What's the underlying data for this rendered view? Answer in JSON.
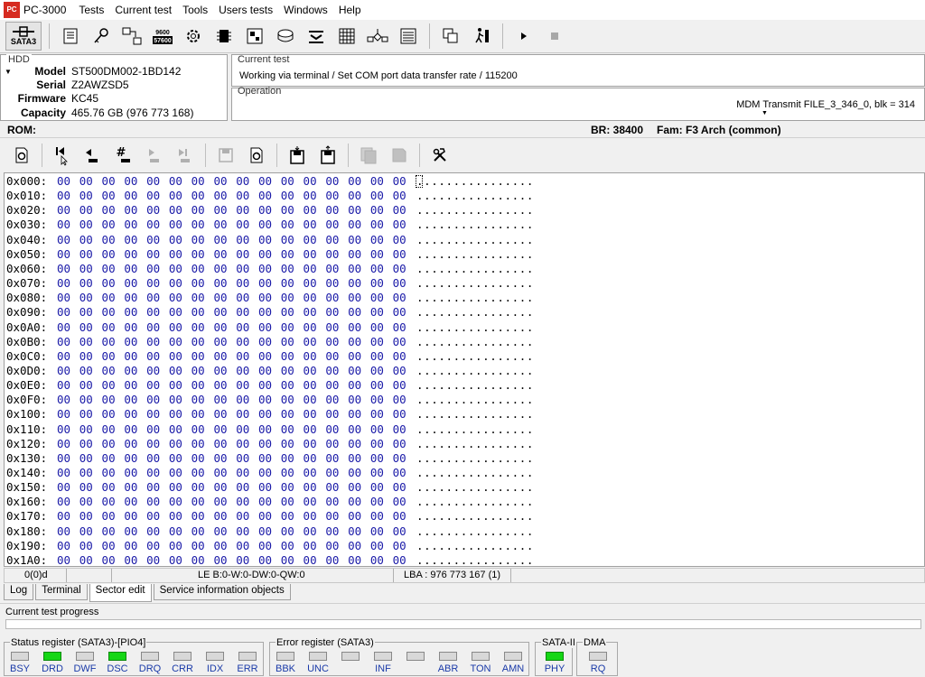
{
  "app": {
    "logo_text": "PC",
    "title": "PC-3000",
    "menu": [
      "Tests",
      "Current test",
      "Tools",
      "Users tests",
      "Windows",
      "Help"
    ]
  },
  "toolbar": {
    "sata3_label": "SATA3",
    "rate_top": "9600",
    "rate_bottom": "57600"
  },
  "hdd": {
    "legend": "HDD",
    "rows": [
      {
        "label": "Model",
        "value": "ST500DM002-1BD142"
      },
      {
        "label": "Serial",
        "value": "Z2AWZSD5"
      },
      {
        "label": "Firmware",
        "value": "KC45"
      },
      {
        "label": "Capacity",
        "value": "465.76 GB (976 773 168)"
      }
    ]
  },
  "current_test": {
    "legend": "Current test",
    "value": "Working via terminal / Set COM port data transfer rate / 115200"
  },
  "operation": {
    "legend": "Operation",
    "value": "MDM Transmit FILE_3_346_0, blk = 314"
  },
  "rom_bar": {
    "rom": "ROM:",
    "br": "BR: 38400",
    "fam": "Fam: F3 Arch (common)"
  },
  "hex": {
    "offsets": [
      "0x000:",
      "0x010:",
      "0x020:",
      "0x030:",
      "0x040:",
      "0x050:",
      "0x060:",
      "0x070:",
      "0x080:",
      "0x090:",
      "0x0A0:",
      "0x0B0:",
      "0x0C0:",
      "0x0D0:",
      "0x0E0:",
      "0x0F0:",
      "0x100:",
      "0x110:",
      "0x120:",
      "0x130:",
      "0x140:",
      "0x150:",
      "0x160:",
      "0x170:",
      "0x180:",
      "0x190:",
      "0x1A0:"
    ],
    "bytes": "00 00 00 00 00 00 00 00 00 00 00 00 00 00 00 00",
    "ascii": "................"
  },
  "sector_status": {
    "position": "0(0)d",
    "format": "LE B:0-W:0-DW:0-QW:0",
    "lba": "LBA : 976 773 167 (1)"
  },
  "tabs": [
    {
      "label": "Log",
      "active": false
    },
    {
      "label": "Terminal",
      "active": false
    },
    {
      "label": "Sector edit",
      "active": true
    },
    {
      "label": "Service information objects",
      "active": false
    }
  ],
  "progress": {
    "label": "Current test progress",
    "value": 0
  },
  "registers": {
    "status": {
      "legend": "Status register (SATA3)-[PIO4]",
      "leds": [
        {
          "label": "BSY",
          "on": false
        },
        {
          "label": "DRD",
          "on": true
        },
        {
          "label": "DWF",
          "on": false
        },
        {
          "label": "DSC",
          "on": true
        },
        {
          "label": "DRQ",
          "on": false
        },
        {
          "label": "CRR",
          "on": false
        },
        {
          "label": "IDX",
          "on": false
        },
        {
          "label": "ERR",
          "on": false
        }
      ]
    },
    "error": {
      "legend": "Error register (SATA3)",
      "leds": [
        {
          "label": "BBK",
          "on": false
        },
        {
          "label": "UNC",
          "on": false
        },
        {
          "label": "",
          "on": false
        },
        {
          "label": "INF",
          "on": false
        },
        {
          "label": "",
          "on": false
        },
        {
          "label": "ABR",
          "on": false
        },
        {
          "label": "TON",
          "on": false
        },
        {
          "label": "AMN",
          "on": false
        }
      ]
    },
    "sata2": {
      "legend": "SATA-II",
      "leds": [
        {
          "label": "PHY",
          "on": true
        }
      ]
    },
    "dma": {
      "legend": "DMA",
      "leds": [
        {
          "label": "RQ",
          "on": false
        }
      ]
    }
  },
  "colors": {
    "led_on": "#15d615",
    "hex_bytes": "#1a1aa8",
    "logo": "#d62b20"
  }
}
